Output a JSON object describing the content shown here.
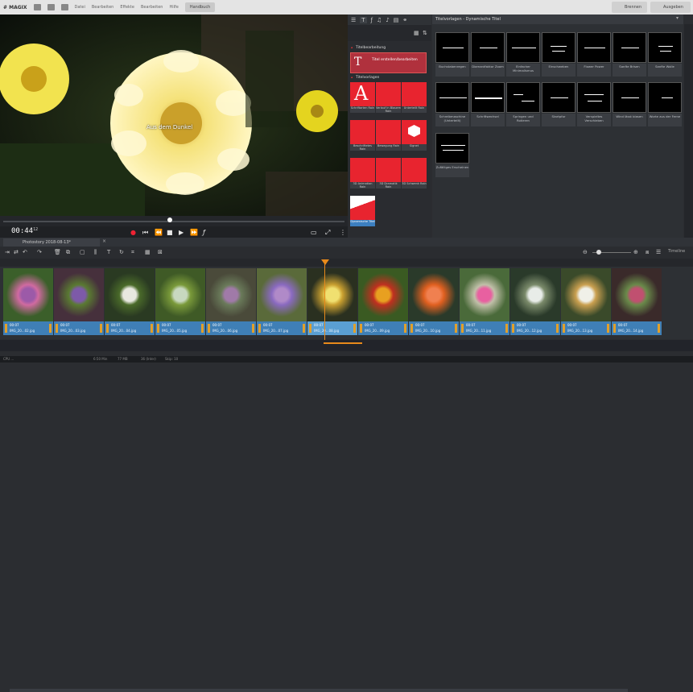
{
  "menubar": {
    "logo": "# MAGIX",
    "items": [
      "Datei",
      "Bearbeiten",
      "Effekte",
      "Bearbeiten",
      "Hilfe"
    ],
    "active": "Handbuch",
    "right": [
      "Brennen",
      "Ausgeben"
    ]
  },
  "preview": {
    "overlay_title": "Aus dem Dunkel",
    "timecode": "00:44",
    "frame": "12"
  },
  "pool": {
    "tabs_icons": [
      "list-icon",
      "text-icon",
      "fx-icon",
      "music-icon",
      "note-icon",
      "template-icon",
      "link-icon"
    ],
    "sec_titlebox": "Titelbearbeitung",
    "titlebox_label": "Titel erstellen/bearbeiten",
    "sec_templates": "Titelvorlagen",
    "tiles": [
      "Schriftarten Rain",
      "Verlauf in Blauem Rain",
      "Unterteilt Rain",
      "Beschriftetes Rain",
      "Bewegung Rain",
      "Signet",
      "3D Animation Rain",
      "3D Dramatik Rain",
      "3D Schwenk Rain",
      "Dynamische Titel"
    ]
  },
  "templates": {
    "header": "Titelvorlagen - Dynamische Titel",
    "items": [
      "Buchstabenregen",
      "Diamantfaktor Zoom",
      "Einfacher Minimalismus",
      "Einschweben",
      "Flower Power",
      "Sanfte Brisen",
      "Sanfte Wolle",
      "Schreibmaschine (Unterteilt)",
      "Schriftwechsel",
      "Springen und Rotieren",
      "Startpfor",
      "Verspieltes Verschieben",
      "Wind lässt blasen",
      "Worte aus der Ferne",
      "Zufälliges Erscheinen"
    ]
  },
  "timeline": {
    "tab": "Photostory 2018-08-13*",
    "label": "Timeline",
    "clips": [
      {
        "tc": "00:07",
        "name": "IMG_20...02.jpg"
      },
      {
        "tc": "00:07",
        "name": "IMG_20...03.jpg"
      },
      {
        "tc": "00:07",
        "name": "IMG_20...04.jpg"
      },
      {
        "tc": "00:07",
        "name": "IMG_20...05.jpg"
      },
      {
        "tc": "00:07",
        "name": "IMG_20...06.jpg"
      },
      {
        "tc": "00:07",
        "name": "IMG_20...07.jpg"
      },
      {
        "tc": "00:07",
        "name": "IMG_20...08.jpg"
      },
      {
        "tc": "00:07",
        "name": "IMG_20...09.jpg"
      },
      {
        "tc": "00:07",
        "name": "IMG_20...10.jpg"
      },
      {
        "tc": "00:07",
        "name": "IMG_20...11.jpg"
      },
      {
        "tc": "00:07",
        "name": "IMG_20...12.jpg"
      },
      {
        "tc": "00:07",
        "name": "IMG_20...13.jpg"
      },
      {
        "tc": "00:07",
        "name": "IMG_20...14.jpg"
      }
    ]
  },
  "status": {
    "left": "CPU ...",
    "mid": "1 Obj",
    "r1": "6:50 Min",
    "r2": "77 MB",
    "r3": "36 (Inter)",
    "r4": "Skip: 10"
  }
}
